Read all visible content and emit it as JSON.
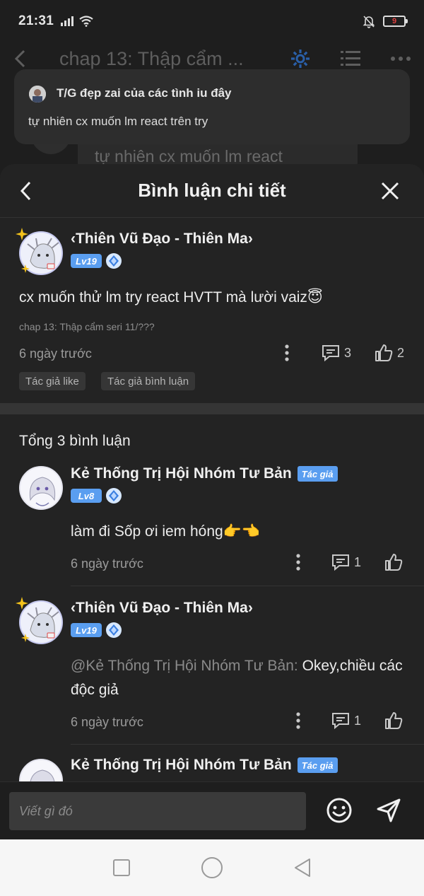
{
  "status_bar": {
    "time": "21:31",
    "battery": "9"
  },
  "background_page": {
    "title": "chap 13: Thập cẩm ...",
    "comment_snippet": "tự nhiên cx muốn lm react"
  },
  "notification": {
    "title": "T/G đẹp zai của các tình iu đây",
    "body": "tự nhiên cx muốn lm react trên try"
  },
  "sheet": {
    "title": "Bình luận chi tiết"
  },
  "main_comment": {
    "author": "‹Thiên Vũ Đạo - Thiên Ma›",
    "level": "Lv19",
    "text": "cx muốn thử lm try react HVTT mà lười vaiz😇",
    "chapter": "chap 13: Thập cẩm seri 11/???",
    "time": "6 ngày trước",
    "reply_count": "3",
    "like_count": "2",
    "tags": [
      "Tác giả like",
      "Tác giả bình luận"
    ]
  },
  "replies_header": "Tổng 3 bình luận",
  "replies": [
    {
      "author": "Kẻ Thống Trị Hội Nhóm Tư Bản",
      "author_tag": "Tác giả",
      "level": "Lv8",
      "text": "làm đi Sốp ơi iem hóng👉👈",
      "time": "6 ngày trước",
      "reply_count": "1"
    },
    {
      "author": "‹Thiên Vũ Đạo - Thiên Ma›",
      "level": "Lv19",
      "mention": "@Kẻ Thống Trị Hội Nhóm Tư Bản:",
      "text": " Okey,chiều các độc giả",
      "time": "6 ngày trước",
      "reply_count": "1"
    },
    {
      "author": "Kẻ Thống Trị Hội Nhóm Tư Bản",
      "author_tag": "Tác giả"
    }
  ],
  "input": {
    "placeholder": "Viết gì đó"
  },
  "colors": {
    "accent": "#5a9ef0",
    "background": "#232323",
    "level_badge": "#5a9ef0"
  }
}
